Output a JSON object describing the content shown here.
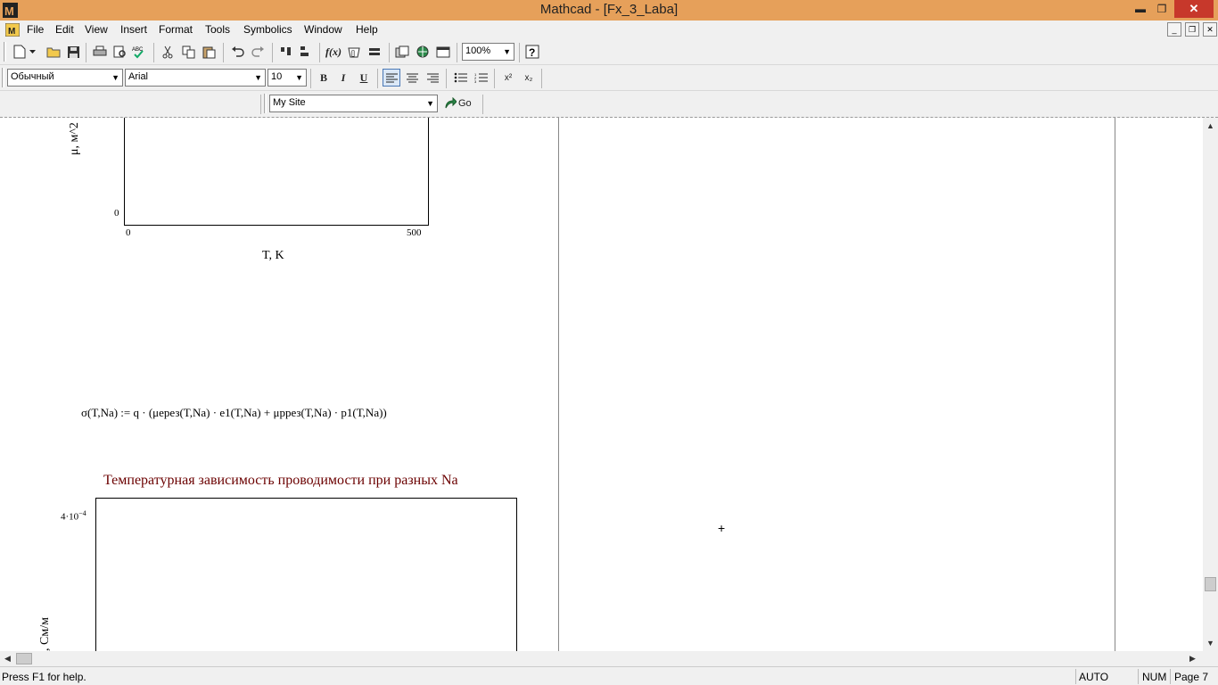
{
  "window": {
    "title": "Mathcad - [Fx_3_Laba]",
    "minimize": "▬",
    "restore": "❐",
    "close": "✕"
  },
  "menu": {
    "items": [
      "File",
      "Edit",
      "View",
      "Insert",
      "Format",
      "Tools",
      "Symbolics",
      "Window",
      "Help"
    ],
    "mdi_min": "_",
    "mdi_restore": "❐",
    "mdi_close": "✕"
  },
  "toolbar": {
    "zoom": "100%"
  },
  "format_bar": {
    "style": "Обычный",
    "font": "Arial",
    "size": "10",
    "bold": "B",
    "italic": "I",
    "underline": "U",
    "superscript": "x²",
    "subscript": "x₂"
  },
  "web_bar": {
    "site": "My Site",
    "go": "Go"
  },
  "worksheet": {
    "plot1": {
      "ylabel": "μ, м^2",
      "y_min_tick": "0",
      "x_min_tick": "0",
      "x_max_tick": "500",
      "xlabel": "T, K"
    },
    "formula": "σ(T,Na) := q · (μерез(T,Na) · e1(T,Na) + μррез(T,Na) · p1(T,Na))",
    "plot2": {
      "title": "Температурная зависимость проводимости при разных Na",
      "y_max_tick_mantissa": "4·10",
      "y_max_tick_exp": "−4",
      "ylabel": ", См/м"
    },
    "cursor": "+"
  },
  "status": {
    "help": "Press F1 for help.",
    "mode": "AUTO",
    "num": "NUM",
    "page": "Page 7"
  }
}
